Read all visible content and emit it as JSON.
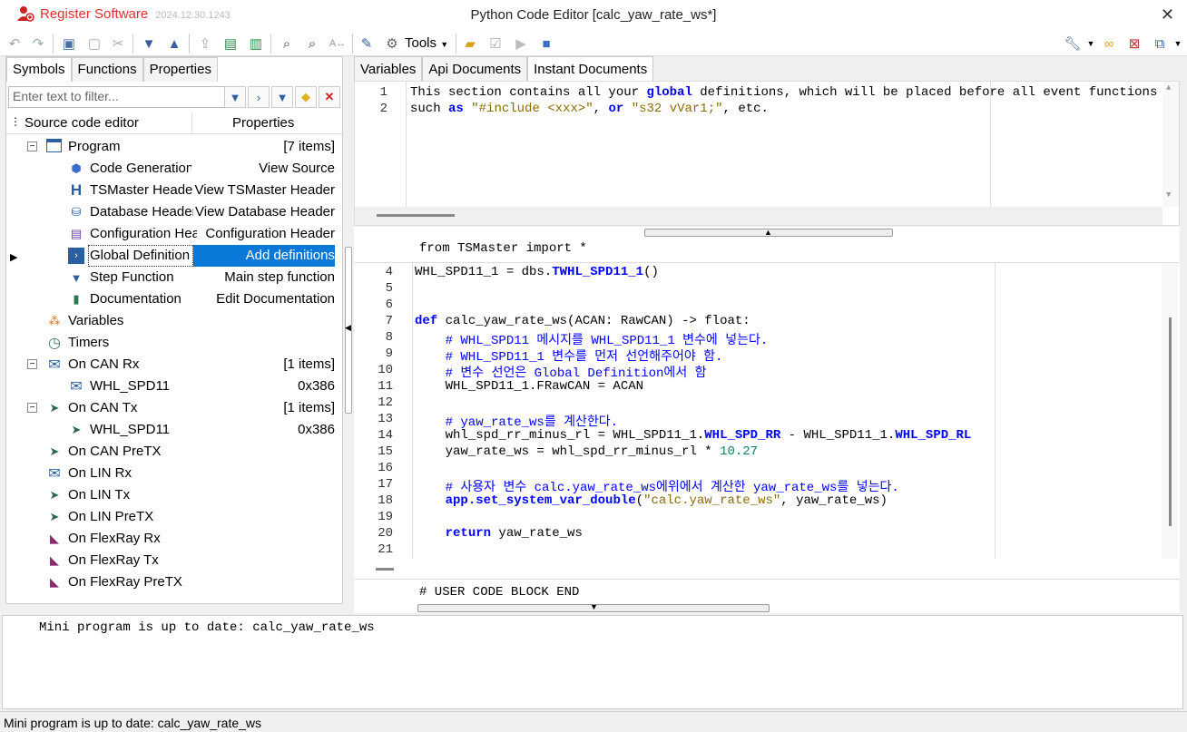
{
  "titlebar": {
    "register": "Register Software",
    "version": "2024.12.30.1243",
    "title": "Python Code Editor [calc_yaw_rate_ws*]",
    "close": "✕"
  },
  "toolbar": {
    "tools_label": "Tools"
  },
  "left": {
    "tabs": [
      "Symbols",
      "Functions",
      "Properties"
    ],
    "filter_placeholder": "Enter text to filter...",
    "header_col1": "Source code editor",
    "header_col2": "Properties",
    "rows": [
      {
        "label": "Program",
        "value": "[7 items]"
      },
      {
        "label": "Code Generation",
        "value": "View Source"
      },
      {
        "label": "TSMaster Header",
        "value": "View TSMaster Header"
      },
      {
        "label": "Database Header",
        "value": "View Database Header"
      },
      {
        "label": "Configuration Header",
        "value": "Configuration Header"
      },
      {
        "label": "Global Definition",
        "value": "Add definitions"
      },
      {
        "label": "Step Function",
        "value": "Main step function"
      },
      {
        "label": "Documentation",
        "value": "Edit Documentation"
      },
      {
        "label": "Variables",
        "value": ""
      },
      {
        "label": "Timers",
        "value": ""
      },
      {
        "label": "On CAN Rx",
        "value": "[1 items]"
      },
      {
        "label": "WHL_SPD11",
        "value": "0x386"
      },
      {
        "label": "On CAN Tx",
        "value": "[1 items]"
      },
      {
        "label": "WHL_SPD11",
        "value": "0x386"
      },
      {
        "label": "On CAN PreTX",
        "value": ""
      },
      {
        "label": "On LIN Rx",
        "value": ""
      },
      {
        "label": "On LIN Tx",
        "value": ""
      },
      {
        "label": "On LIN PreTX",
        "value": ""
      },
      {
        "label": "On FlexRay Rx",
        "value": ""
      },
      {
        "label": "On FlexRay Tx",
        "value": ""
      },
      {
        "label": "On FlexRay PreTX",
        "value": ""
      }
    ]
  },
  "right": {
    "tabs": [
      "Variables",
      "Api Documents",
      "Instant Documents"
    ],
    "top_lines": [
      {
        "n": "1",
        "text": "This section contains all your global definitions, which will be placed before all event functions"
      },
      {
        "n": "2",
        "text": "such as \"#include <xxx>\", or \"s32 vVar1;\", etc."
      }
    ],
    "header_line": "from TSMaster import *",
    "footer_line": "# USER CODE BLOCK END",
    "code_lines": [
      "4",
      "5",
      "6",
      "7",
      "8",
      "9",
      "10",
      "11",
      "12",
      "13",
      "14",
      "15",
      "16",
      "17",
      "18",
      "19",
      "20",
      "21"
    ]
  },
  "output": {
    "text": "Mini program is up to date: calc_yaw_rate_ws"
  },
  "status": {
    "text": "Mini program is up to date: calc_yaw_rate_ws"
  }
}
